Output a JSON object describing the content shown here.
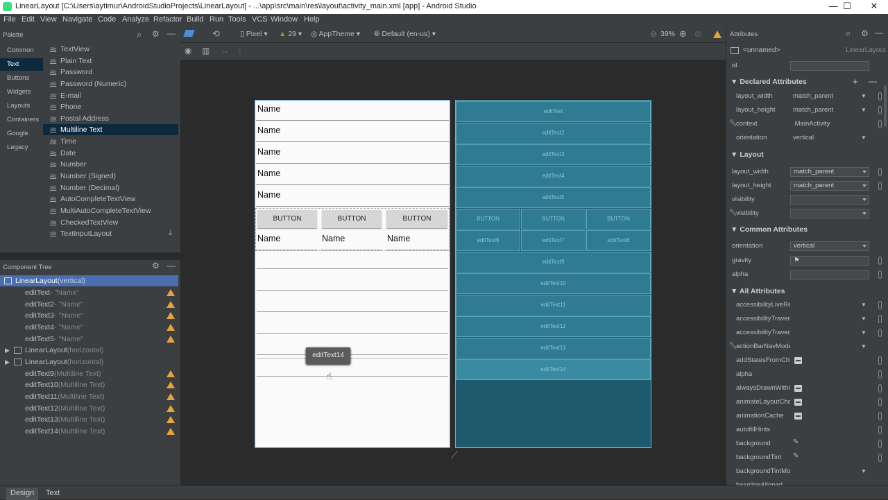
{
  "window": {
    "title": "LinearLayout [C:\\Users\\aytimur\\AndroidStudioProjects\\LinearLayout] - ...\\app\\src\\main\\res\\layout\\activity_main.xml [app] - Android Studio",
    "controls": [
      "—",
      "☐",
      "✕"
    ]
  },
  "menu": [
    "File",
    "Edit",
    "View",
    "Navigate",
    "Code",
    "Analyze",
    "Refactor",
    "Build",
    "Run",
    "Tools",
    "VCS",
    "Window",
    "Help"
  ],
  "toolbar": {
    "device": "Pixel",
    "api": "29",
    "theme": "AppTheme",
    "locale": "Default (en-us)",
    "zoom": "39%"
  },
  "palette": {
    "title": "Palette",
    "categories": [
      "Common",
      "Text",
      "Buttons",
      "Widgets",
      "Layouts",
      "Containers",
      "Google",
      "Legacy"
    ],
    "selected_category": "Text",
    "items": [
      "TextView",
      "Plain Text",
      "Password",
      "Password (Numeric)",
      "E-mail",
      "Phone",
      "Postal Address",
      "Multiline Text",
      "Time",
      "Date",
      "Number",
      "Number (Signed)",
      "Number (Decimal)",
      "AutoCompleteTextView",
      "MultiAutoCompleteTextView",
      "CheckedTextView",
      "TextInputLayout"
    ],
    "selected_item": "Multiline Text",
    "ab_glyph": "Ab"
  },
  "tree": {
    "title": "Component Tree",
    "rows": [
      {
        "name": "LinearLayout",
        "extra": "(vertical)"
      },
      {
        "name": "editText",
        "extra": "- \"Name\""
      },
      {
        "name": "editText2",
        "extra": "- \"Name\""
      },
      {
        "name": "editText3",
        "extra": "- \"Name\""
      },
      {
        "name": "editText4",
        "extra": "- \"Name\""
      },
      {
        "name": "editText5",
        "extra": "- \"Name\""
      },
      {
        "name": "LinearLayout",
        "extra": "(horizontal)"
      },
      {
        "name": "LinearLayout",
        "extra": "(horizontal)"
      },
      {
        "name": "editText9",
        "extra": "(Multiline Text)"
      },
      {
        "name": "editText10",
        "extra": "(Multiline Text)"
      },
      {
        "name": "editText11",
        "extra": "(Multiline Text)"
      },
      {
        "name": "editText12",
        "extra": "(Multiline Text)"
      },
      {
        "name": "editText13",
        "extra": "(Multiline Text)"
      },
      {
        "name": "editText14",
        "extra": "(Multiline Text)"
      }
    ]
  },
  "preview": {
    "name_inputs": [
      "Name",
      "Name",
      "Name",
      "Name",
      "Name"
    ],
    "buttons": [
      "BUTTON",
      "BUTTON",
      "BUTTON"
    ],
    "row_inputs": [
      "Name",
      "Name",
      "Name"
    ],
    "tooltip": "editText14"
  },
  "blueprint": {
    "rows": [
      "editText",
      "editText2",
      "editText3",
      "editText4",
      "editText5"
    ],
    "buttons": [
      "BUTTON",
      "BUTTON",
      "BUTTON"
    ],
    "row_edits": [
      "editText6",
      "editText7",
      "editText8"
    ],
    "multi": [
      "editText9",
      "editText10",
      "editText11",
      "editText12",
      "editText13",
      "editText14"
    ]
  },
  "attributes": {
    "title": "Attributes",
    "component": "<unnamed>",
    "component_type": "LinearLayout",
    "id_label": "id",
    "declared_title": "Declared Attributes",
    "declared": [
      {
        "key": "layout_width",
        "value": "match_parent"
      },
      {
        "key": "layout_height",
        "value": "match_parent"
      },
      {
        "key": "context",
        "value": ".MainActivity"
      },
      {
        "key": "orientation",
        "value": "vertical"
      }
    ],
    "layout_title": "Layout",
    "layout": [
      {
        "key": "layout_width",
        "value": "match_parent"
      },
      {
        "key": "layout_height",
        "value": "match_parent"
      },
      {
        "key": "visibility",
        "value": ""
      },
      {
        "key": "visibility",
        "value": ""
      }
    ],
    "common_title": "Common Attributes",
    "common": [
      {
        "key": "orientation",
        "value": "vertical"
      },
      {
        "key": "gravity",
        "value": "⚑"
      },
      {
        "key": "alpha",
        "value": ""
      }
    ],
    "all_title": "All Attributes",
    "all": [
      "accessibilityLiveReg",
      "accessibilityTravers",
      "accessibilityTravers",
      "actionBarNavMode",
      "addStatesFromChil",
      "alpha",
      "alwaysDrawnWithC",
      "animateLayoutCha",
      "animationCache",
      "autofillHints",
      "background",
      "backgroundTint",
      "backgroundTintMo",
      "baselineAligned"
    ]
  },
  "bottom_tabs": [
    "Design",
    "Text"
  ],
  "selected_bottom_tab": "Design",
  "colors": {
    "accent": "#4b6eaf",
    "warning": "#e8a33a",
    "blueprint": "#1e5a6e"
  }
}
